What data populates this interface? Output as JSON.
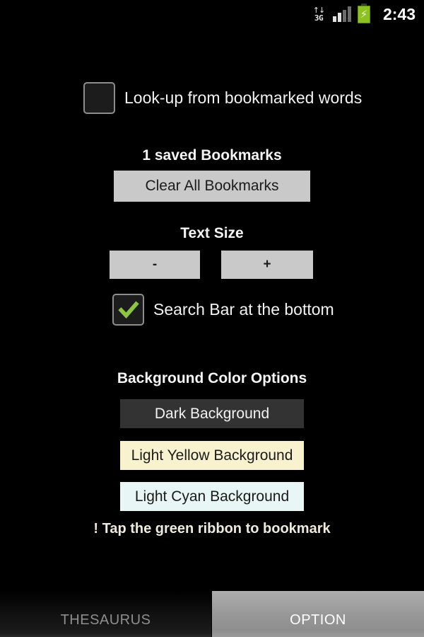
{
  "status_bar": {
    "network_label": "3G",
    "network_arrows": "↑↓",
    "clock": "2:43",
    "battery_glyph": "⚡"
  },
  "options": {
    "lookup_checkbox": {
      "label": "Look-up from bookmarked words",
      "checked": false
    },
    "bookmarks": {
      "count_label": "1 saved Bookmarks",
      "clear_button": "Clear All Bookmarks"
    },
    "text_size": {
      "title": "Text Size",
      "decrease_label": "-",
      "increase_label": "+"
    },
    "search_bar_checkbox": {
      "label": "Search Bar at the bottom",
      "checked": true
    },
    "background_colors": {
      "title": "Background Color Options",
      "dark_label": "Dark Background",
      "light_yellow_label": "Light Yellow Background",
      "light_cyan_label": "Light Cyan Background"
    },
    "tip": "! Tap the green ribbon to bookmark"
  },
  "tabs": {
    "thesaurus_label": "THESAURUS",
    "option_label": "OPTION",
    "active": "OPTION"
  },
  "colors": {
    "background": "#000000",
    "check_green": "#8cc63f",
    "button_light": "#c9c9c9",
    "button_dark": "#333333",
    "light_yellow": "#f8f2cf",
    "light_cyan": "#e9f6f6",
    "battery_green": "#8bc220"
  }
}
